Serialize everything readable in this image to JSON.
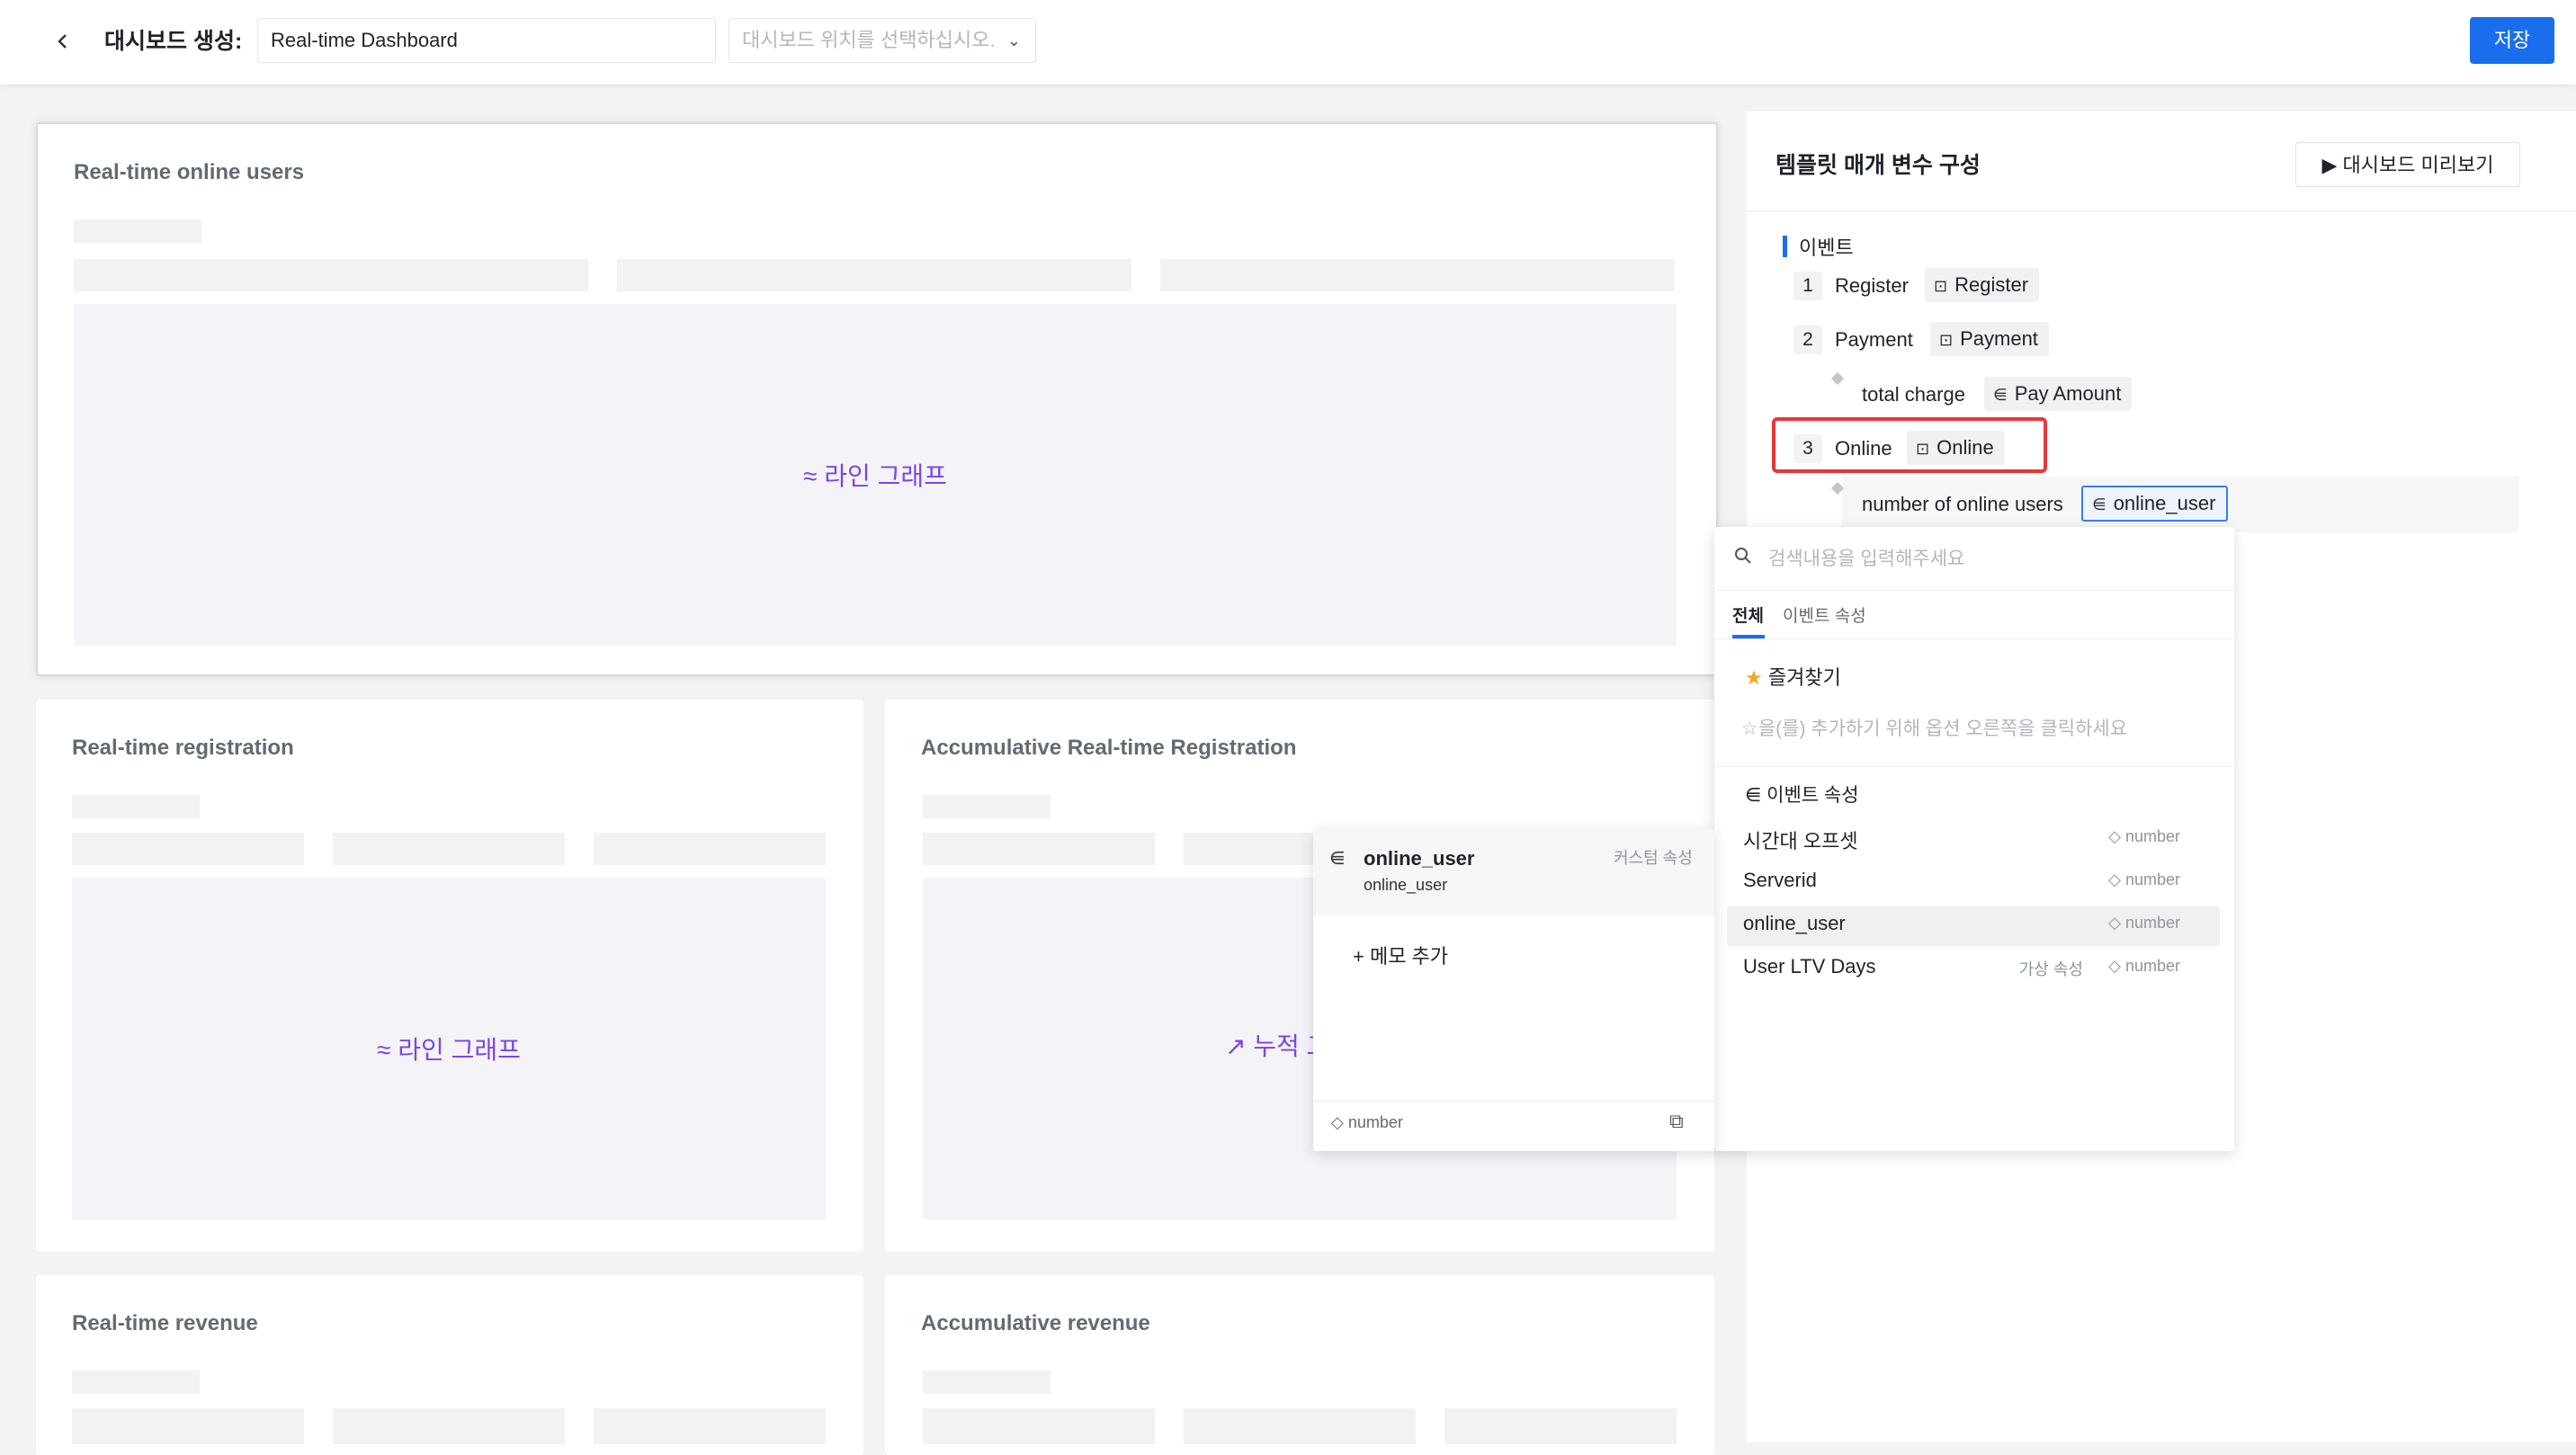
{
  "header": {
    "back_icon": "chevron-left-icon",
    "title_label": "대시보드 생성:",
    "name_value": "Real-time Dashboard",
    "location_placeholder": "대시보드 위치를 선택하십시오.",
    "save_label": "저장"
  },
  "cards": [
    {
      "title": "Real-time online users",
      "chart_label": "라인 그래프"
    },
    {
      "title": "Real-time registration",
      "chart_label": "라인 그래프"
    },
    {
      "title": "Accumulative Real-time Registration",
      "chart_label": "누적 그"
    },
    {
      "title": "Real-time revenue"
    },
    {
      "title": "Accumulative revenue"
    }
  ],
  "panel": {
    "title": "템플릿 매개 변수 구성",
    "preview_label": "대시보드 미리보기",
    "section_label": "이벤트",
    "events": [
      {
        "index": "1",
        "name": "Register",
        "value": "Register"
      },
      {
        "index": "2",
        "name": "Payment",
        "value": "Payment",
        "property": {
          "name": "total charge",
          "value": "Pay Amount"
        }
      },
      {
        "index": "3",
        "name": "Online",
        "value": "Online",
        "property": {
          "name": "number of online users",
          "value": "online_user"
        }
      }
    ]
  },
  "dropdown": {
    "search_placeholder": "검색내용을 입력해주세요",
    "tabs": [
      "전체",
      "이벤트 속성"
    ],
    "favorites_label": "즐겨찾기",
    "favorites_hint": "☆을(를) 추가하기 위해 옵션 오른쪽을 클릭하세요",
    "group_label": "이벤트 속성",
    "options": [
      {
        "name": "시간대 오프셋",
        "virtual": "",
        "type": "number"
      },
      {
        "name": "Serverid",
        "virtual": "",
        "type": "number"
      },
      {
        "name": "online_user",
        "virtual": "",
        "type": "number"
      },
      {
        "name": "User LTV Days",
        "virtual": "가상 속성",
        "type": "number"
      }
    ]
  },
  "detail": {
    "name": "online_user",
    "sub": "online_user",
    "badge": "커스텀 속성",
    "memo_label": "메모 추가",
    "type": "number"
  },
  "colors": {
    "accent": "#1a6eed",
    "chart_label": "#7a45e5",
    "highlight_box": "#e8363a",
    "star": "#f5a623"
  }
}
